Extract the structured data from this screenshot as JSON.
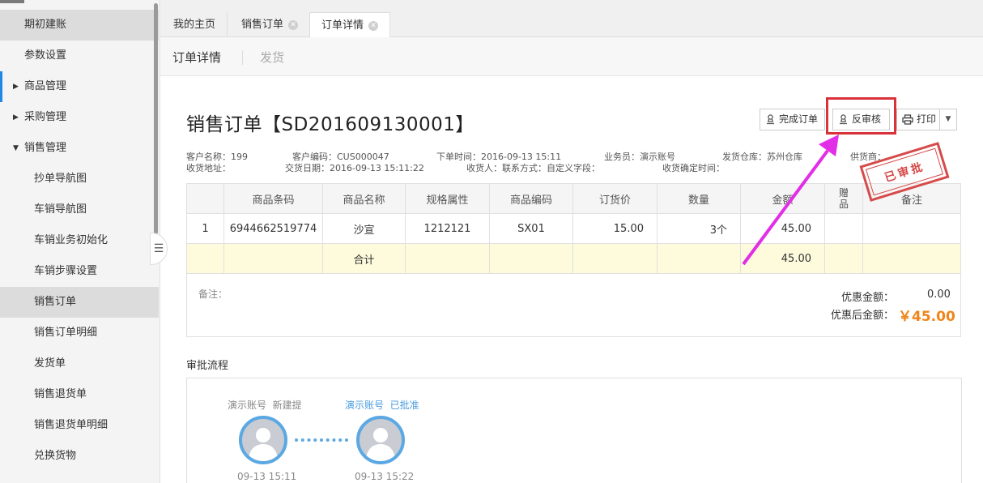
{
  "sidebar": {
    "items": [
      {
        "label": "期初建账"
      },
      {
        "label": "参数设置"
      },
      {
        "label": "商品管理"
      },
      {
        "label": "采购管理"
      },
      {
        "label": "销售管理"
      },
      {
        "label": "抄单导航图"
      },
      {
        "label": "车销导航图"
      },
      {
        "label": "车销业务初始化"
      },
      {
        "label": "车销步骤设置"
      },
      {
        "label": "销售订单"
      },
      {
        "label": "销售订单明细"
      },
      {
        "label": "发货单"
      },
      {
        "label": "销售退货单"
      },
      {
        "label": "销售退货单明细"
      },
      {
        "label": "兑换货物"
      }
    ]
  },
  "tabs": [
    {
      "label": "我的主页"
    },
    {
      "label": "销售订单"
    },
    {
      "label": "订单详情"
    }
  ],
  "subnav": {
    "detail": "订单详情",
    "ship": "发货"
  },
  "order": {
    "title": "销售订单【SD201609130001】",
    "buttons": {
      "complete": "完成订单",
      "unaudit": "反审核",
      "print": "打印"
    },
    "info": {
      "customer_name": "客户名称：199",
      "customer_code": "客户编码：CUS000047",
      "order_time": "下单时间：2016-09-13 15:11",
      "salesperson": "业务员：演示账号",
      "warehouse": "发货仓库：苏州仓库",
      "supplier": "供货商：",
      "address": "收货地址：",
      "delivery_date": "交货日期：2016-09-13 15:11:22",
      "receiver": "收货人：联系方式：自定义字段：",
      "confirm_time": "收货确定时间："
    },
    "stamp": "已审批"
  },
  "table": {
    "headers": [
      "",
      "商品条码",
      "商品名称",
      "规格属性",
      "商品编码",
      "订货价",
      "数量",
      "金额",
      "赠品",
      "备注"
    ],
    "rows": [
      {
        "idx": "1",
        "barcode": "6944662519774",
        "name": "沙宣",
        "spec": "1212121",
        "code": "SX01",
        "price": "15.00",
        "qty": "3个",
        "amount": "45.00",
        "gift": "",
        "note": ""
      }
    ],
    "total": {
      "label": "合计",
      "amount": "45.00"
    }
  },
  "summary": {
    "remark_label": "备注：",
    "discount_label": "优惠金额：",
    "discount_value": "0.00",
    "after_label": "优惠后金额：",
    "after_value": "￥45.00"
  },
  "approval": {
    "title": "审批流程",
    "steps": [
      {
        "label": "演示账号  新建提",
        "time": "09-13 15:11"
      },
      {
        "label": "演示账号  已批准",
        "time": "09-13 15:22"
      }
    ]
  },
  "colors": {
    "accent_blue": "#5ba8e3",
    "highlight_red": "#d9323a",
    "arrow_magenta": "#e22ee6",
    "price_orange": "#f08519"
  }
}
